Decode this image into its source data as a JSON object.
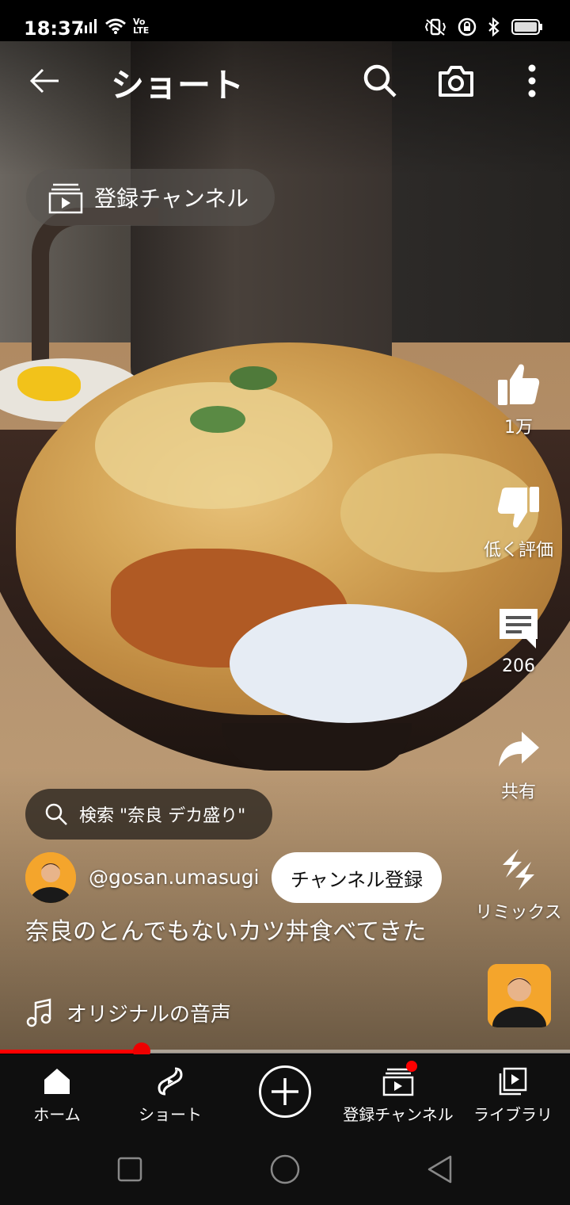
{
  "status_bar": {
    "time": "18:37",
    "network_label": "Vo LTE"
  },
  "top_bar": {
    "title": "ショート"
  },
  "subscriptions_chip": {
    "label": "登録チャンネル"
  },
  "actions": {
    "like_count": "1万",
    "dislike_label": "低く評価",
    "comment_count": "206",
    "share_label": "共有",
    "remix_label": "リミックス"
  },
  "search_suggestion": {
    "label": "検索 \"奈良 デカ盛り\""
  },
  "channel": {
    "handle": "@gosan.umasugi",
    "subscribe_label": "チャンネル登録"
  },
  "video": {
    "title": "奈良のとんでもないカツ丼食べてきた",
    "audio_label": "オリジナルの音声",
    "progress": 0.248
  },
  "bottom_nav": {
    "home": "ホーム",
    "shorts": "ショート",
    "subscriptions": "登録チャンネル",
    "library": "ライブラリ"
  },
  "colors": {
    "accent_red": "#ff0000",
    "nav_background": "#0f0f0f"
  }
}
